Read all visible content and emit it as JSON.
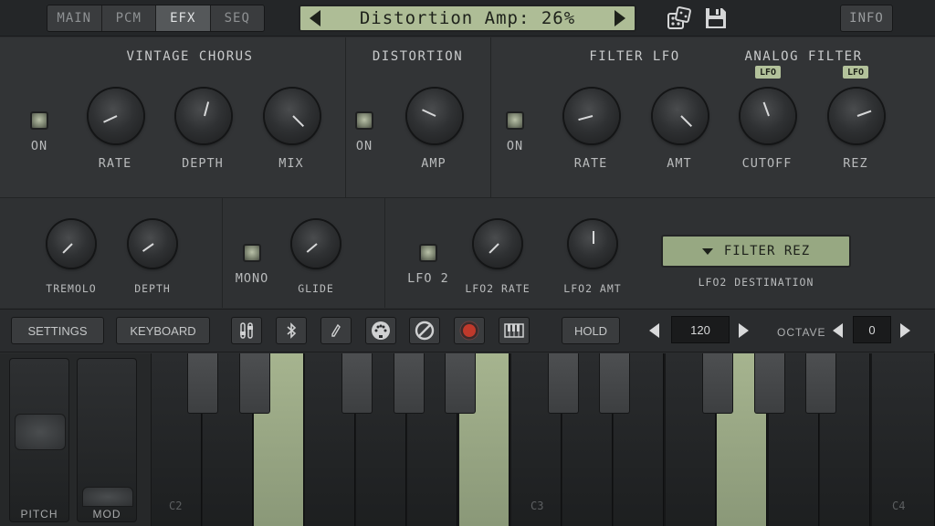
{
  "tabs": [
    "MAIN",
    "PCM",
    "EFX",
    "SEQ"
  ],
  "active_tab": "EFX",
  "display": {
    "text": "Distortion Amp: 26%"
  },
  "info_label": "INFO",
  "vintage_chorus": {
    "title": "VINTAGE CHORUS",
    "on_label": "ON",
    "rate_label": "RATE",
    "depth_label": "DEPTH",
    "mix_label": "MIX"
  },
  "distortion": {
    "title": "DISTORTION",
    "on_label": "ON",
    "amp_label": "AMP"
  },
  "filter_lfo": {
    "title": "FILTER LFO",
    "on_label": "ON",
    "rate_label": "RATE",
    "amt_label": "AMT"
  },
  "analog_filter": {
    "title": "ANALOG FILTER",
    "lfo_badge": "LFO",
    "cutoff_label": "CUTOFF",
    "rez_label": "REZ"
  },
  "tremolo": {
    "tremolo_label": "TREMOLO",
    "depth_label": "DEPTH"
  },
  "mono_glide": {
    "mono_label": "MONO",
    "glide_label": "GLIDE"
  },
  "lfo2": {
    "lfo2_label": "LFO 2",
    "rate_label": "LFO2 RATE",
    "amt_label": "LFO2 AMT",
    "destination_value": "FILTER REZ",
    "destination_label": "LFO2 DESTINATION"
  },
  "toolbar": {
    "settings_label": "SETTINGS",
    "keyboard_label": "KEYBOARD",
    "hold_label": "HOLD",
    "tempo_value": "120",
    "octave_label": "OCTAVE",
    "octave_value": "0"
  },
  "wheels": {
    "pitch_label": "PITCH",
    "mod_label": "MOD"
  },
  "keyboard": {
    "note_labels": [
      "C2",
      "C3",
      "C4"
    ]
  },
  "colors": {
    "lcd": "#aebd96",
    "accent": "#97a882",
    "record": "#c0392b"
  }
}
